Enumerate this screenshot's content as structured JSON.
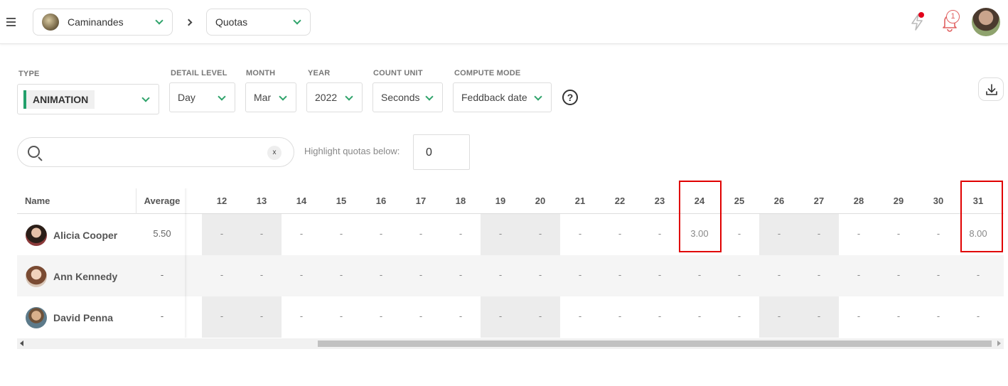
{
  "breadcrumb": {
    "production": "Caminandes",
    "page": "Quotas"
  },
  "notifications": {
    "count": "1"
  },
  "filters": {
    "type": {
      "label": "TYPE",
      "value": "ANIMATION"
    },
    "detail_level": {
      "label": "DETAIL LEVEL",
      "value": "Day"
    },
    "month": {
      "label": "MONTH",
      "value": "Mar"
    },
    "year": {
      "label": "YEAR",
      "value": "2022"
    },
    "count_unit": {
      "label": "COUNT UNIT",
      "value": "Seconds"
    },
    "compute_mode": {
      "label": "COMPUTE MODE",
      "value": "Feddback date"
    },
    "help": "?"
  },
  "search": {
    "value": "",
    "clear": "x"
  },
  "highlight": {
    "label": "Highlight quotas below:",
    "value": "0"
  },
  "table": {
    "headers": {
      "name": "Name",
      "average": "Average"
    },
    "days": [
      "12",
      "13",
      "14",
      "15",
      "16",
      "17",
      "18",
      "19",
      "20",
      "21",
      "22",
      "23",
      "24",
      "25",
      "26",
      "27",
      "28",
      "29",
      "30",
      "31"
    ],
    "rows": [
      {
        "name": "Alicia Cooper",
        "average": "5.50",
        "values": [
          "-",
          "-",
          "-",
          "-",
          "-",
          "-",
          "-",
          "-",
          "-",
          "-",
          "-",
          "-",
          "3.00",
          "-",
          "-",
          "-",
          "-",
          "-",
          "-",
          "8.00"
        ]
      },
      {
        "name": "Ann Kennedy",
        "average": "-",
        "values": [
          "-",
          "-",
          "-",
          "-",
          "-",
          "-",
          "-",
          "-",
          "-",
          "-",
          "-",
          "-",
          "-",
          "-",
          "-",
          "-",
          "-",
          "-",
          "-",
          "-"
        ]
      },
      {
        "name": "David Penna",
        "average": "-",
        "values": [
          "-",
          "-",
          "-",
          "-",
          "-",
          "-",
          "-",
          "-",
          "-",
          "-",
          "-",
          "-",
          "-",
          "-",
          "-",
          "-",
          "-",
          "-",
          "-",
          "-"
        ]
      }
    ]
  },
  "colors": {
    "accent": "#22a06b",
    "highlight": "#e00000",
    "weekend": "#ececec"
  }
}
